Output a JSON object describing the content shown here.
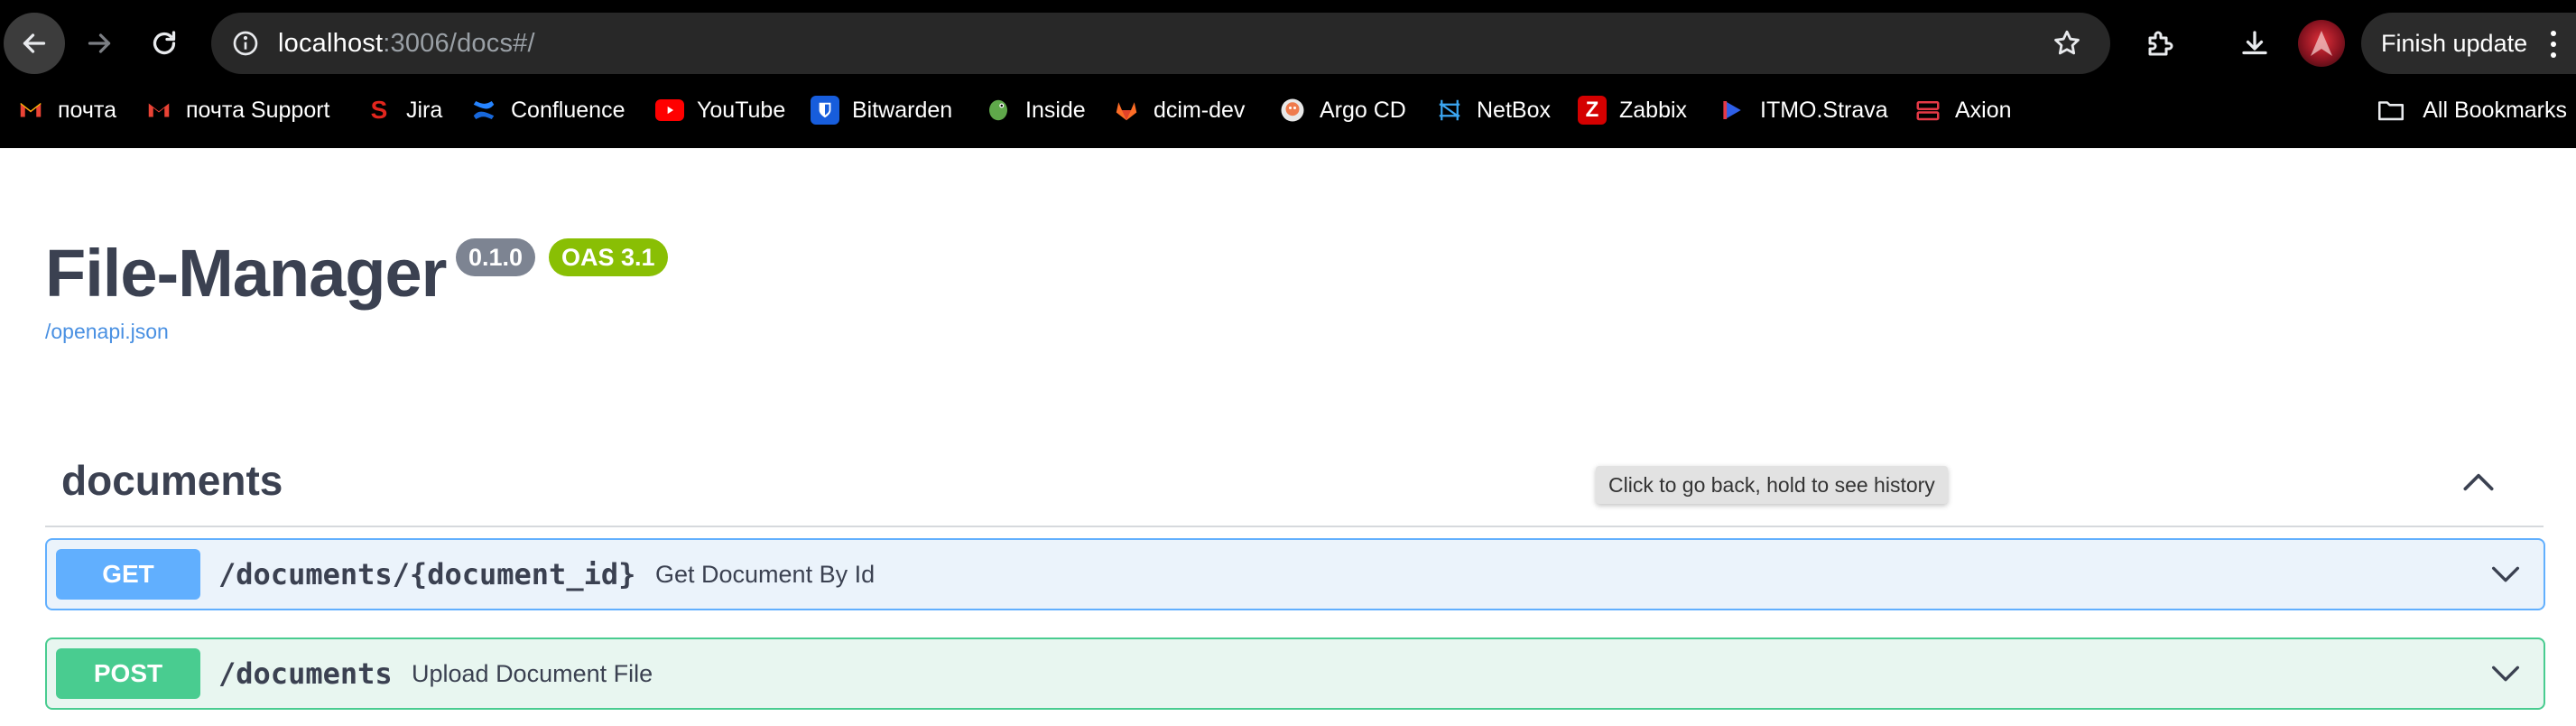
{
  "browser": {
    "url_host": "localhost",
    "url_rest": ":3006/docs#/",
    "finish_update_label": "Finish update",
    "bookmarks": [
      {
        "label": "почта",
        "icon": "gmail-icon",
        "color": "#ea4335"
      },
      {
        "label": "почта Support",
        "icon": "gmail-icon",
        "color": "#ea4335"
      },
      {
        "label": "Jira",
        "icon": "jira-icon",
        "color": "#e2261e"
      },
      {
        "label": "Confluence",
        "icon": "confluence-icon",
        "color": "#1868db"
      },
      {
        "label": "YouTube",
        "icon": "youtube-icon",
        "color": "#ff0000"
      },
      {
        "label": "Bitwarden",
        "icon": "bitwarden-icon",
        "color": "#175ddc"
      },
      {
        "label": "Inside",
        "icon": "inside-icon",
        "color": "#5fa84a"
      },
      {
        "label": "dcim-dev",
        "icon": "gitlab-icon",
        "color": "#fc6d26"
      },
      {
        "label": "Argo CD",
        "icon": "argo-icon",
        "color": "#ef7b4d"
      },
      {
        "label": "NetBox",
        "icon": "netbox-icon",
        "color": "#3ba6f2"
      },
      {
        "label": "Zabbix",
        "icon": "zabbix-icon",
        "color": "#d40000"
      },
      {
        "label": "ITMO.Strava",
        "icon": "itmo-icon",
        "color": "#2e5fe8"
      },
      {
        "label": "Axion",
        "icon": "axion-icon",
        "color": "#e53946"
      }
    ],
    "all_bookmarks_label": "All Bookmarks",
    "tooltip": "Click to go back, hold to see history"
  },
  "page": {
    "title": "File-Manager",
    "version_badge": "0.1.0",
    "oas_badge": "OAS 3.1",
    "spec_link": "/openapi.json"
  },
  "tag": {
    "name": "documents",
    "operations": [
      {
        "method": "GET",
        "path": "/documents/{document_id}",
        "summary": "Get Document By Id",
        "color": "#61affe"
      },
      {
        "method": "POST",
        "path": "/documents",
        "summary": "Upload Document File",
        "color": "#49cc90"
      }
    ]
  }
}
